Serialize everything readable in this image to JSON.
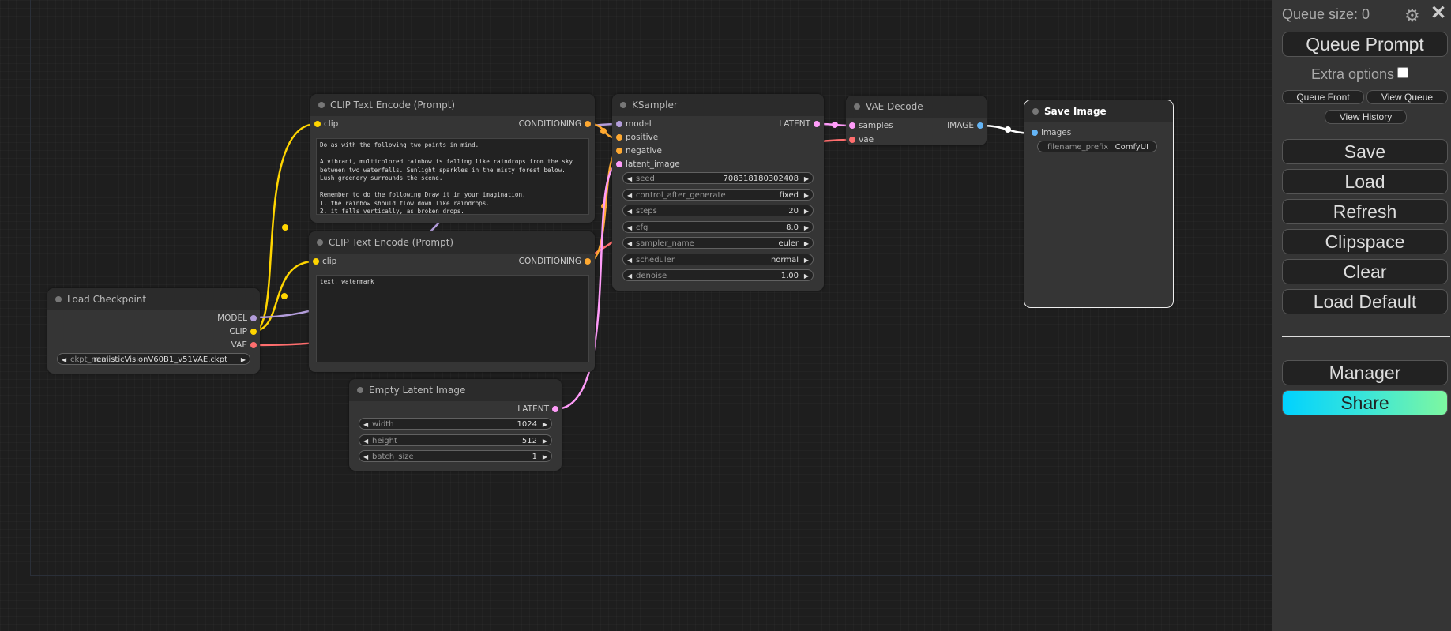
{
  "colors": {
    "clip": "#ffd500",
    "conditioning": "#ffa931",
    "model": "#b39ddb",
    "latent": "#ff9cf9",
    "vae": "#ff6e6e",
    "image": "#64b5f6",
    "canvas_bg": "#1e1e1e",
    "node_bg": "#353535",
    "share_gradient": [
      "#00d2ff",
      "#7ef7a0"
    ]
  },
  "nodes": {
    "clip_pos": {
      "title": "CLIP Text Encode (Prompt)",
      "input": "clip",
      "output": "CONDITIONING",
      "text": "Do as with the following two points in mind.\n\nA vibrant, multicolored rainbow is falling like raindrops from the sky\nbetween two waterfalls. Sunlight sparkles in the misty forest below.\nLush greenery surrounds the scene.\n\nRemember to do the following Draw it in your imagination.\n1. the rainbow should flow down like raindrops.\n2. it falls vertically, as broken drops."
    },
    "clip_neg": {
      "title": "CLIP Text Encode (Prompt)",
      "input": "clip",
      "output": "CONDITIONING",
      "text": "text, watermark"
    },
    "load_ckpt": {
      "title": "Load Checkpoint",
      "outputs": [
        "MODEL",
        "CLIP",
        "VAE"
      ],
      "widget_label": "ckpt_nam",
      "widget_value": "realisticVisionV60B1_v51VAE.ckpt"
    },
    "ksampler": {
      "title": "KSampler",
      "inputs": [
        "model",
        "positive",
        "negative",
        "latent_image"
      ],
      "output": "LATENT",
      "widgets": [
        {
          "label": "seed",
          "value": "708318180302408"
        },
        {
          "label": "control_after_generate",
          "value": "fixed"
        },
        {
          "label": "steps",
          "value": "20"
        },
        {
          "label": "cfg",
          "value": "8.0"
        },
        {
          "label": "sampler_name",
          "value": "euler"
        },
        {
          "label": "scheduler",
          "value": "normal"
        },
        {
          "label": "denoise",
          "value": "1.00"
        }
      ]
    },
    "vae_decode": {
      "title": "VAE Decode",
      "inputs": [
        "samples",
        "vae"
      ],
      "output": "IMAGE"
    },
    "save_image": {
      "title": "Save Image",
      "input": "images",
      "widget_label": "filename_prefix",
      "widget_value": "ComfyUI"
    },
    "empty_latent": {
      "title": "Empty Latent Image",
      "output": "LATENT",
      "widgets": [
        {
          "label": "width",
          "value": "1024"
        },
        {
          "label": "height",
          "value": "512"
        },
        {
          "label": "batch_size",
          "value": "1"
        }
      ]
    }
  },
  "menu": {
    "queue_size": "Queue size: 0",
    "queue_prompt": "Queue Prompt",
    "extra_options": "Extra options",
    "queue_front": "Queue Front",
    "view_queue": "View Queue",
    "view_history": "View History",
    "save": "Save",
    "load": "Load",
    "refresh": "Refresh",
    "clipspace": "Clipspace",
    "clear": "Clear",
    "load_default": "Load Default",
    "manager": "Manager",
    "share": "Share",
    "gear_icon": "gear-icon",
    "close_icon": "close-icon"
  }
}
